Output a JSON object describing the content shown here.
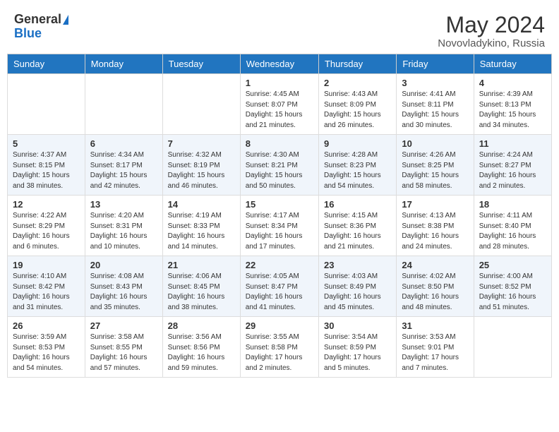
{
  "header": {
    "logo_general": "General",
    "logo_blue": "Blue",
    "month_year": "May 2024",
    "location": "Novovladykino, Russia"
  },
  "weekdays": [
    "Sunday",
    "Monday",
    "Tuesday",
    "Wednesday",
    "Thursday",
    "Friday",
    "Saturday"
  ],
  "weeks": [
    [
      {
        "day": "",
        "info": ""
      },
      {
        "day": "",
        "info": ""
      },
      {
        "day": "",
        "info": ""
      },
      {
        "day": "1",
        "info": "Sunrise: 4:45 AM\nSunset: 8:07 PM\nDaylight: 15 hours\nand 21 minutes."
      },
      {
        "day": "2",
        "info": "Sunrise: 4:43 AM\nSunset: 8:09 PM\nDaylight: 15 hours\nand 26 minutes."
      },
      {
        "day": "3",
        "info": "Sunrise: 4:41 AM\nSunset: 8:11 PM\nDaylight: 15 hours\nand 30 minutes."
      },
      {
        "day": "4",
        "info": "Sunrise: 4:39 AM\nSunset: 8:13 PM\nDaylight: 15 hours\nand 34 minutes."
      }
    ],
    [
      {
        "day": "5",
        "info": "Sunrise: 4:37 AM\nSunset: 8:15 PM\nDaylight: 15 hours\nand 38 minutes."
      },
      {
        "day": "6",
        "info": "Sunrise: 4:34 AM\nSunset: 8:17 PM\nDaylight: 15 hours\nand 42 minutes."
      },
      {
        "day": "7",
        "info": "Sunrise: 4:32 AM\nSunset: 8:19 PM\nDaylight: 15 hours\nand 46 minutes."
      },
      {
        "day": "8",
        "info": "Sunrise: 4:30 AM\nSunset: 8:21 PM\nDaylight: 15 hours\nand 50 minutes."
      },
      {
        "day": "9",
        "info": "Sunrise: 4:28 AM\nSunset: 8:23 PM\nDaylight: 15 hours\nand 54 minutes."
      },
      {
        "day": "10",
        "info": "Sunrise: 4:26 AM\nSunset: 8:25 PM\nDaylight: 15 hours\nand 58 minutes."
      },
      {
        "day": "11",
        "info": "Sunrise: 4:24 AM\nSunset: 8:27 PM\nDaylight: 16 hours\nand 2 minutes."
      }
    ],
    [
      {
        "day": "12",
        "info": "Sunrise: 4:22 AM\nSunset: 8:29 PM\nDaylight: 16 hours\nand 6 minutes."
      },
      {
        "day": "13",
        "info": "Sunrise: 4:20 AM\nSunset: 8:31 PM\nDaylight: 16 hours\nand 10 minutes."
      },
      {
        "day": "14",
        "info": "Sunrise: 4:19 AM\nSunset: 8:33 PM\nDaylight: 16 hours\nand 14 minutes."
      },
      {
        "day": "15",
        "info": "Sunrise: 4:17 AM\nSunset: 8:34 PM\nDaylight: 16 hours\nand 17 minutes."
      },
      {
        "day": "16",
        "info": "Sunrise: 4:15 AM\nSunset: 8:36 PM\nDaylight: 16 hours\nand 21 minutes."
      },
      {
        "day": "17",
        "info": "Sunrise: 4:13 AM\nSunset: 8:38 PM\nDaylight: 16 hours\nand 24 minutes."
      },
      {
        "day": "18",
        "info": "Sunrise: 4:11 AM\nSunset: 8:40 PM\nDaylight: 16 hours\nand 28 minutes."
      }
    ],
    [
      {
        "day": "19",
        "info": "Sunrise: 4:10 AM\nSunset: 8:42 PM\nDaylight: 16 hours\nand 31 minutes."
      },
      {
        "day": "20",
        "info": "Sunrise: 4:08 AM\nSunset: 8:43 PM\nDaylight: 16 hours\nand 35 minutes."
      },
      {
        "day": "21",
        "info": "Sunrise: 4:06 AM\nSunset: 8:45 PM\nDaylight: 16 hours\nand 38 minutes."
      },
      {
        "day": "22",
        "info": "Sunrise: 4:05 AM\nSunset: 8:47 PM\nDaylight: 16 hours\nand 41 minutes."
      },
      {
        "day": "23",
        "info": "Sunrise: 4:03 AM\nSunset: 8:49 PM\nDaylight: 16 hours\nand 45 minutes."
      },
      {
        "day": "24",
        "info": "Sunrise: 4:02 AM\nSunset: 8:50 PM\nDaylight: 16 hours\nand 48 minutes."
      },
      {
        "day": "25",
        "info": "Sunrise: 4:00 AM\nSunset: 8:52 PM\nDaylight: 16 hours\nand 51 minutes."
      }
    ],
    [
      {
        "day": "26",
        "info": "Sunrise: 3:59 AM\nSunset: 8:53 PM\nDaylight: 16 hours\nand 54 minutes."
      },
      {
        "day": "27",
        "info": "Sunrise: 3:58 AM\nSunset: 8:55 PM\nDaylight: 16 hours\nand 57 minutes."
      },
      {
        "day": "28",
        "info": "Sunrise: 3:56 AM\nSunset: 8:56 PM\nDaylight: 16 hours\nand 59 minutes."
      },
      {
        "day": "29",
        "info": "Sunrise: 3:55 AM\nSunset: 8:58 PM\nDaylight: 17 hours\nand 2 minutes."
      },
      {
        "day": "30",
        "info": "Sunrise: 3:54 AM\nSunset: 8:59 PM\nDaylight: 17 hours\nand 5 minutes."
      },
      {
        "day": "31",
        "info": "Sunrise: 3:53 AM\nSunset: 9:01 PM\nDaylight: 17 hours\nand 7 minutes."
      },
      {
        "day": "",
        "info": ""
      }
    ]
  ]
}
